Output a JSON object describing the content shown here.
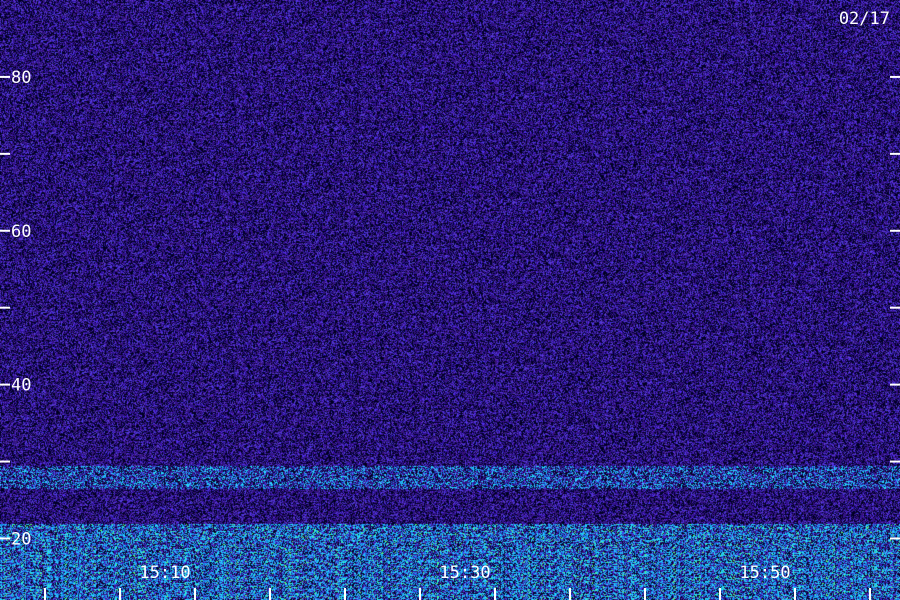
{
  "date_label": "02/17",
  "colors": {
    "background": "#2a0f80",
    "noise_dark": "#000000",
    "noise_light": "#5a3cff",
    "band_cyan": "#29c6ff",
    "band_green": "#5bff6a",
    "ticks": "#ffffff",
    "labels": "#ffffff"
  },
  "chart_data": {
    "type": "heatmap",
    "title": "",
    "xlabel": "",
    "ylabel": "",
    "date": "02/17",
    "x_tick_labels": [
      {
        "t": "15:10",
        "label": "15:10"
      },
      {
        "t": "15:30",
        "label": "15:30"
      },
      {
        "t": "15:50",
        "label": "15:50"
      }
    ],
    "x_minor_ticks": [
      "15:02",
      "15:07",
      "15:12",
      "15:17",
      "15:22",
      "15:27",
      "15:32",
      "15:37",
      "15:42",
      "15:47",
      "15:52",
      "15:57"
    ],
    "xlim": [
      "14:59",
      "15:59"
    ],
    "y_tick_labels": [
      20,
      40,
      60,
      80
    ],
    "y_minor_ticks": [
      30,
      50,
      70
    ],
    "ylim": [
      12,
      90
    ],
    "bands": [
      {
        "freq_low": 26.5,
        "freq_high": 29.5,
        "intensity": 0.55,
        "description": "faint cyan band"
      },
      {
        "freq_low": 12,
        "freq_high": 22,
        "intensity": 0.8,
        "description": "strong cyan/green activity"
      }
    ],
    "grid": false,
    "legend": "none"
  }
}
